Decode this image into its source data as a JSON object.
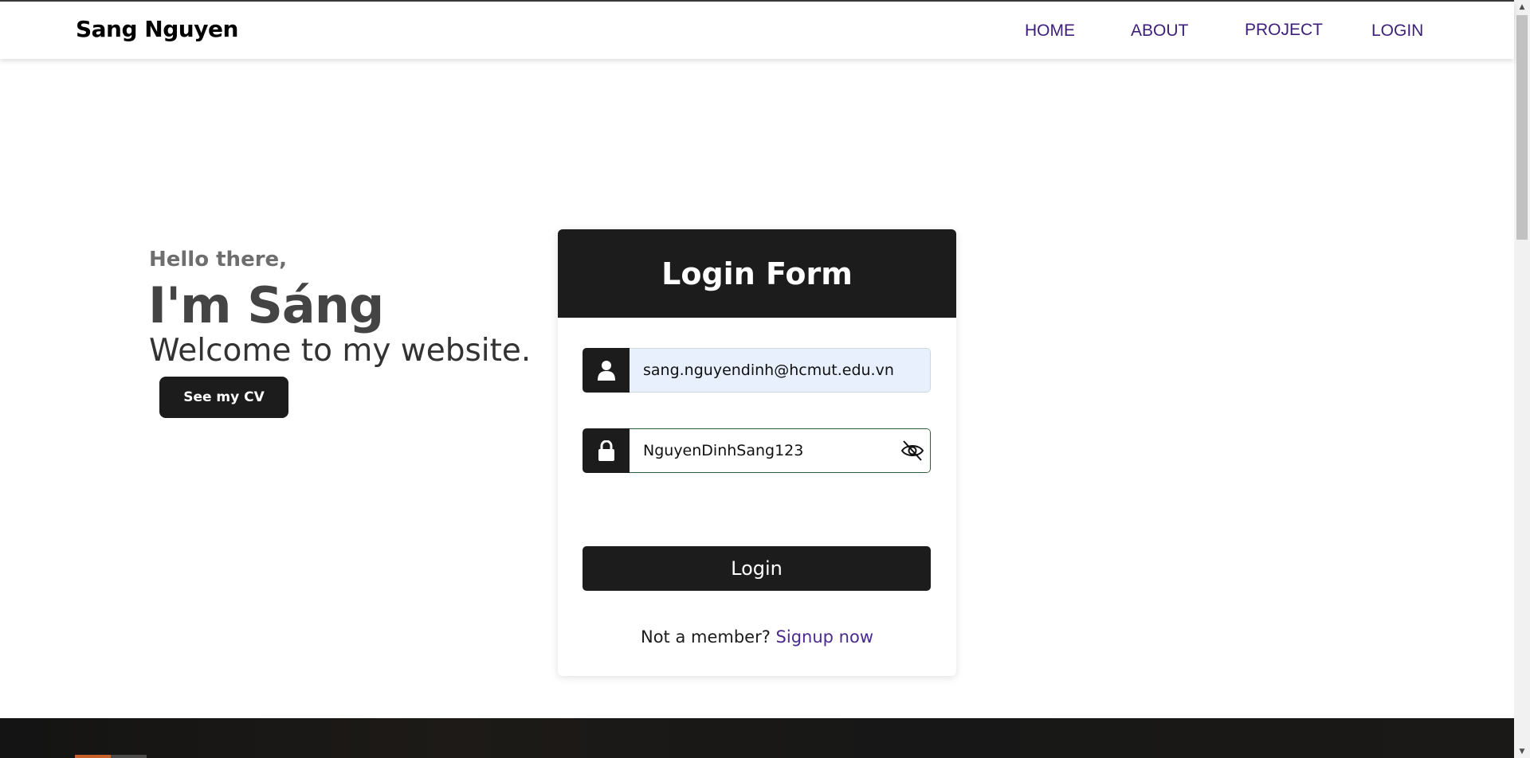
{
  "navbar": {
    "brand": "Sang Nguyen",
    "links": [
      "HOME",
      "ABOUT",
      "PROJECT",
      "LOGIN"
    ]
  },
  "hero": {
    "greeting": "Hello there,",
    "headline": "I'm Sáng",
    "welcome": "Welcome to my website.",
    "cv_button": "See my CV"
  },
  "login_form": {
    "title": "Login Form",
    "email_value": "sang.nguyendinh@hcmut.edu.vn",
    "password_value": "NguyenDinhSang123",
    "submit_label": "Login",
    "signup_prompt": "Not a member?",
    "signup_link": "Signup now"
  },
  "icons": {
    "email_field": "user-icon",
    "password_field": "lock-icon",
    "password_toggle": "eye-slash-icon"
  },
  "colors": {
    "nav_link": "#3d1e7a",
    "dark": "#1c1c1c",
    "signup_link": "#4a2a8c",
    "autofill_bg": "#e8f0fe"
  }
}
